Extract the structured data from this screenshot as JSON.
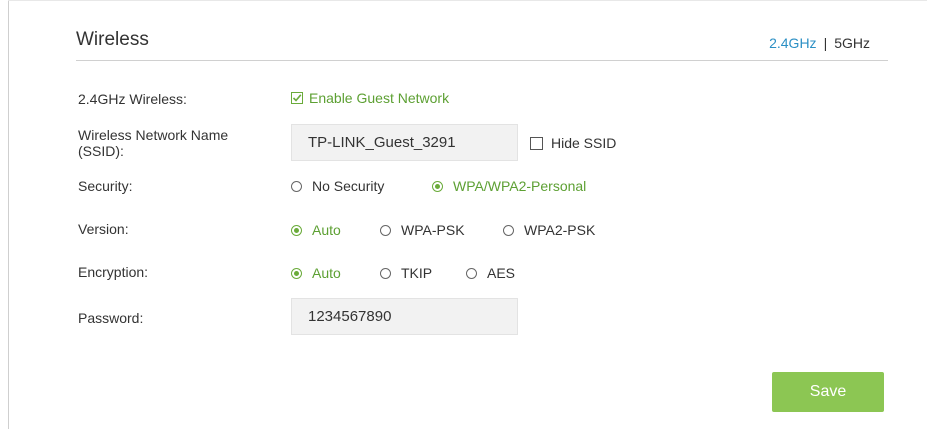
{
  "header": {
    "title": "Wireless",
    "band_24": "2.4GHz",
    "separator": "|",
    "band_5": "5GHz"
  },
  "form": {
    "wireless_label": "2.4GHz Wireless:",
    "enable_guest": {
      "label": "Enable Guest Network",
      "checked": true
    },
    "ssid_label_line1": "Wireless Network Name",
    "ssid_label_line2": "(SSID):",
    "ssid_value": "TP-LINK_Guest_3291",
    "hide_ssid": {
      "label": "Hide SSID",
      "checked": false
    },
    "security_label": "Security:",
    "security_options": [
      "No Security",
      "WPA/WPA2-Personal"
    ],
    "security_selected": "WPA/WPA2-Personal",
    "version_label": "Version:",
    "version_options": [
      "Auto",
      "WPA-PSK",
      "WPA2-PSK"
    ],
    "version_selected": "Auto",
    "encryption_label": "Encryption:",
    "encryption_options": [
      "Auto",
      "TKIP",
      "AES"
    ],
    "encryption_selected": "Auto",
    "password_label": "Password:",
    "password_value": "1234567890"
  },
  "actions": {
    "save_label": "Save"
  },
  "colors": {
    "accent_green": "#6aab3a",
    "button_green": "#8cc653",
    "link_blue": "#2b8fc4"
  }
}
